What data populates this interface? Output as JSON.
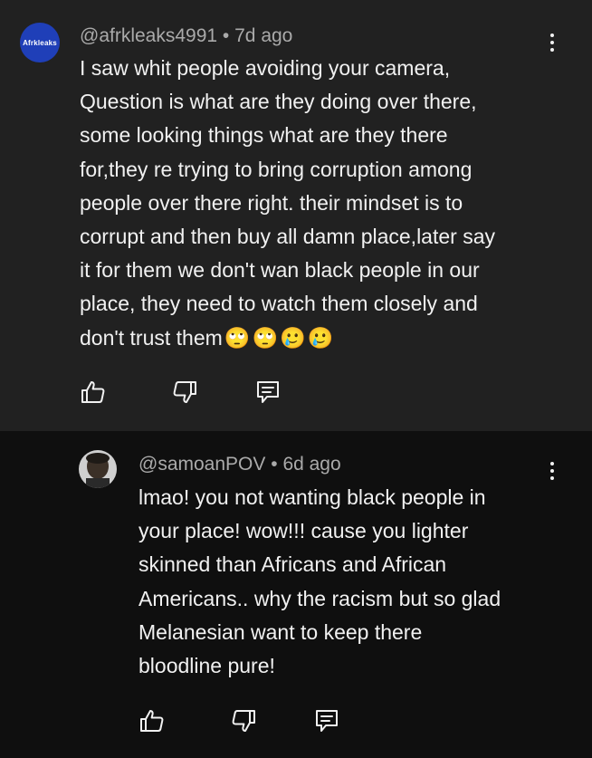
{
  "comments": [
    {
      "avatar_text": "Afrkleaks",
      "author": "@afrkleaks4991",
      "time": "7d ago",
      "lines": [
        "I saw whit people avoiding your  camera,",
        "Question is  what are they doing over there,",
        "some looking things  what are they there",
        "for,they re trying to bring corruption among",
        "people  over there right. their mindset is to",
        "corrupt and then buy all damn place,later say",
        "it for them we don't wan black people in our",
        "place, they need to watch them closely and",
        "don't trust them"
      ],
      "emojis": [
        "🙄",
        "🙄",
        "🥲",
        "🥲"
      ]
    },
    {
      "author": "@samoanPOV",
      "time": "6d ago",
      "lines": [
        "lmao! you not wanting black people in",
        "your place! wow!!! cause you lighter",
        "skinned than Africans and African",
        "Americans.. why the racism but so glad",
        "Melanesian want to keep there",
        "bloodline pure!"
      ]
    }
  ],
  "icons": {
    "like": "thumbs-up-icon",
    "dislike": "thumbs-down-icon",
    "reply": "reply-icon",
    "menu": "more-vert-icon"
  },
  "colors": {
    "comment_bg": "#212121",
    "reply_bg": "#0f0f0f",
    "text": "#f1f1f1",
    "meta": "#aaaaaa",
    "avatar1": "#1f3fb8"
  },
  "meta_separator": "•"
}
